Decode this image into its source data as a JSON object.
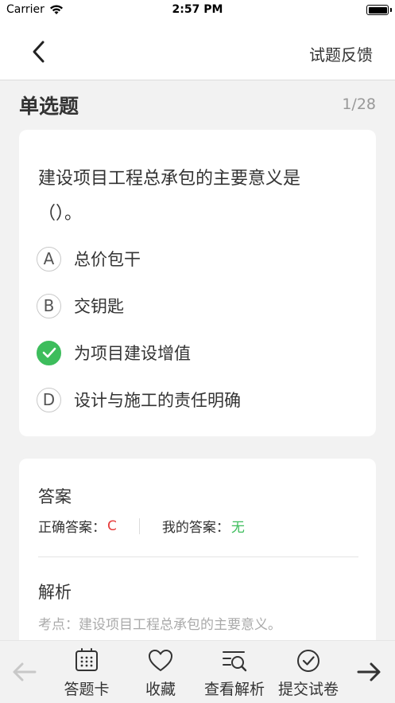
{
  "status_bar": {
    "carrier": "Carrier",
    "time": "2:57 PM"
  },
  "nav": {
    "feedback_label": "试题反馈"
  },
  "header": {
    "question_type": "单选题",
    "progress": "1/28"
  },
  "question": {
    "text_line1": "建设项目工程总承包的主要意义是",
    "text_line2": "（）。",
    "options": [
      {
        "letter": "A",
        "label": "总价包干",
        "checked": false
      },
      {
        "letter": "B",
        "label": "交钥匙",
        "checked": false
      },
      {
        "letter": "C",
        "label": "为项目建设增值",
        "checked": true
      },
      {
        "letter": "D",
        "label": "设计与施工的责任明确",
        "checked": false
      }
    ]
  },
  "answer": {
    "title": "答案",
    "correct_label": "正确答案：",
    "correct_value": "C",
    "mine_label": "我的答案：",
    "mine_value": "无",
    "analysis_title": "解析",
    "analysis_text": "考点：建设项目工程总承包的主要意义。"
  },
  "toolbar": {
    "answer_card": "答题卡",
    "favorite": "收藏",
    "view_analysis": "查看解析",
    "submit": "提交试卷"
  },
  "colors": {
    "correct_red": "#e63b3b",
    "check_green": "#3dbd5c",
    "background": "#f2f2f2"
  }
}
